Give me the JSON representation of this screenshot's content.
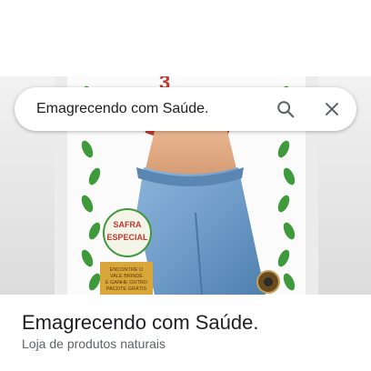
{
  "search": {
    "query": "Emagrecendo com Saúde."
  },
  "place": {
    "name": "Emagrecendo com Saúde.",
    "category": "Loja de produtos naturais"
  },
  "photo": {
    "badge_line1": "SAFRA",
    "badge_line2": "ESPECIAL",
    "promo": [
      "ENCONTRE O",
      "VALE BRINDE",
      "E GANHE OUTRO",
      "PACOTE GRÁTIS"
    ]
  },
  "icons": {
    "search": "search-icon",
    "close": "close-icon"
  },
  "colors": {
    "text_primary": "#202124",
    "text_secondary": "#5f6368",
    "icon": "#5f6368",
    "leaf_green": "#3f9a3c",
    "label_red": "#c0392b",
    "denim": "#6f9cc9"
  }
}
